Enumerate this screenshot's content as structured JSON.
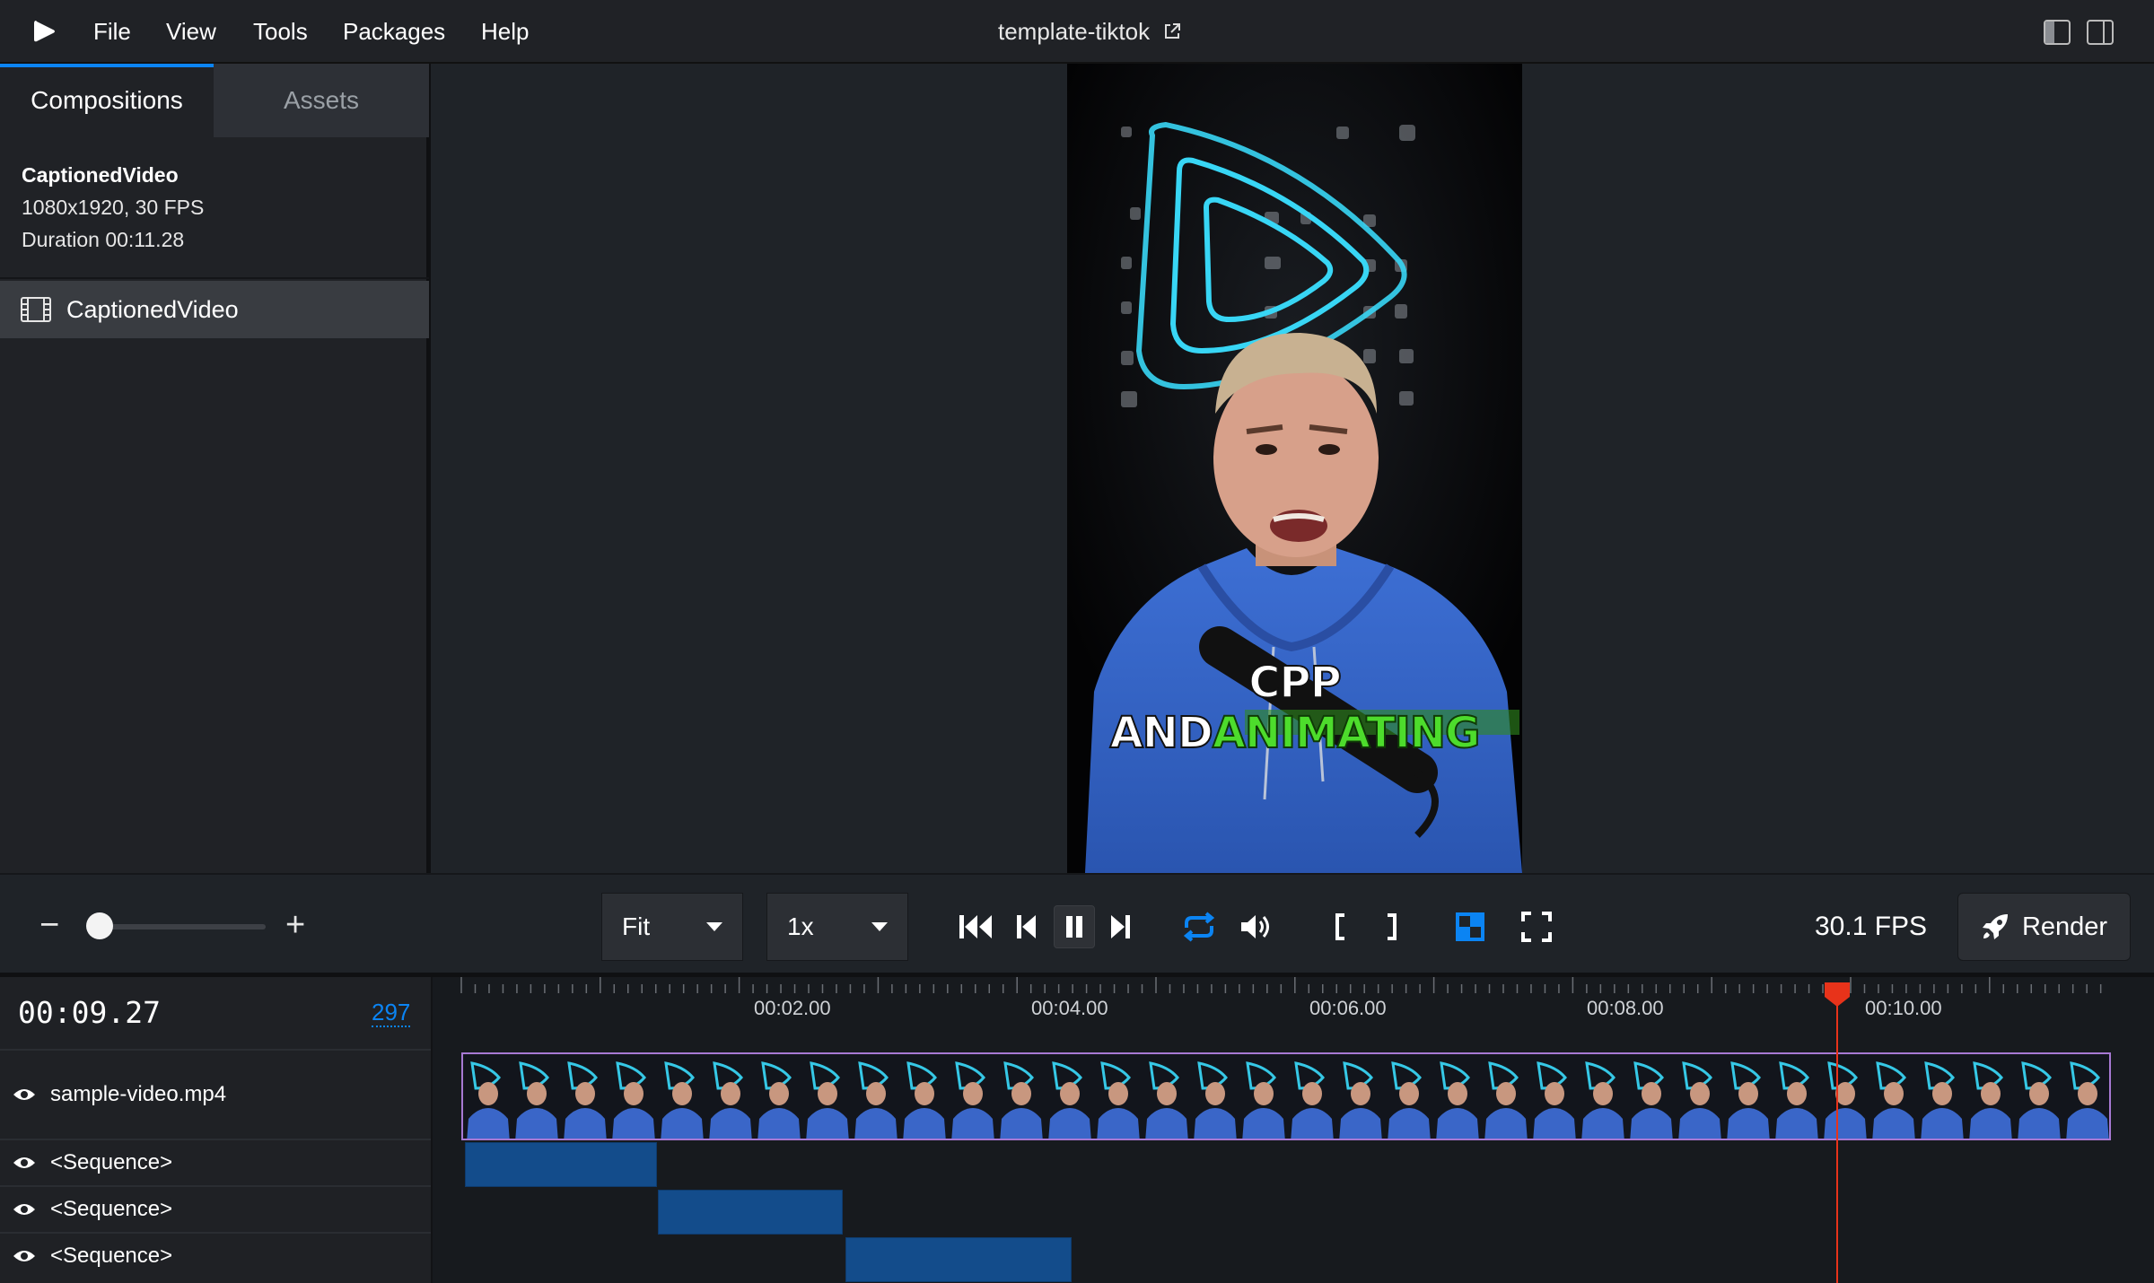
{
  "menu": {
    "items": [
      "File",
      "View",
      "Tools",
      "Packages",
      "Help"
    ],
    "project_title": "template-tiktok"
  },
  "sidebar": {
    "tabs": [
      "Compositions",
      "Assets"
    ],
    "active_tab": "Compositions",
    "composition": {
      "name": "CaptionedVideo",
      "size_fps": "1080x1920, 30 FPS",
      "duration": "Duration 00:11.28"
    },
    "list": [
      {
        "label": "CaptionedVideo"
      }
    ]
  },
  "preview": {
    "caption_white": "CPP AND",
    "caption_green": "ANIMATING"
  },
  "controls": {
    "zoom_minus": "−",
    "zoom_plus": "+",
    "zoom_level": 0.0,
    "fit_select": "Fit",
    "speed_select": "1x",
    "fps": "30.1 FPS",
    "render_label": "Render",
    "accent_color": "#0b84f3"
  },
  "timeline": {
    "timecode": "00:09.27",
    "frame": "297",
    "ticks": [
      "00:02.00",
      "00:04.00",
      "00:06.00",
      "00:08.00",
      "00:10.00"
    ],
    "playhead_seconds": 9.9,
    "tracks": [
      {
        "label": "sample-video.mp4",
        "type": "video"
      },
      {
        "label": "<Sequence>",
        "type": "sequence"
      },
      {
        "label": "<Sequence>",
        "type": "sequence"
      },
      {
        "label": "<Sequence>",
        "type": "sequence"
      }
    ],
    "playhead_color": "#e8331a"
  }
}
